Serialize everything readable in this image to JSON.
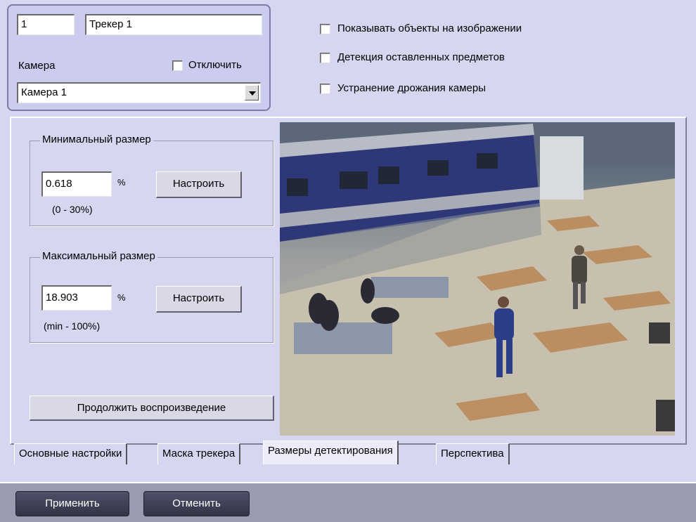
{
  "tracker": {
    "id": "1",
    "name": "Трекер 1",
    "camera_label": "Камера",
    "disable_label": "Отключить",
    "camera_selected": "Камера 1"
  },
  "options": {
    "show_objects": "Показывать объекты на изображении",
    "left_items": "Детекция оставленных предметов",
    "stabilization": "Устранение дрожания камеры"
  },
  "min_size": {
    "title": "Минимальный размер",
    "value": "0.618",
    "unit": "%",
    "button": "Настроить",
    "range": "(0 - 30%)"
  },
  "max_size": {
    "title": "Максимальный размер",
    "value": "18.903",
    "unit": "%",
    "button": "Настроить",
    "range": "(min - 100%)"
  },
  "continue_button": "Продолжить воспроизведение",
  "tabs": [
    {
      "label": "Основные настройки"
    },
    {
      "label": "Маска трекера"
    },
    {
      "label": "Размеры детектирования"
    },
    {
      "label": "Перспектива"
    }
  ],
  "footer": {
    "apply": "Применить",
    "cancel": "Отменить"
  },
  "colors": {
    "background": "#d6d6f0",
    "footer": "#9a9ab0",
    "dark_button": "#3c3f55"
  }
}
